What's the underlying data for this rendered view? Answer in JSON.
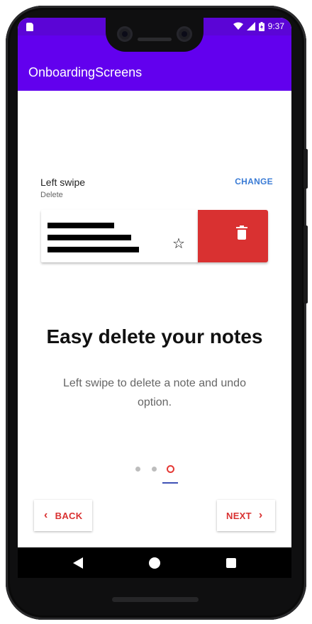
{
  "status_bar": {
    "time": "9:37"
  },
  "app_bar": {
    "title": "OnboardingScreens"
  },
  "demo": {
    "title": "Left swipe",
    "subtitle": "Delete",
    "change_label": "CHANGE"
  },
  "onboarding": {
    "headline": "Easy delete your notes",
    "description": "Left swipe to delete a note and undo option.",
    "page_index": 3,
    "page_count": 3
  },
  "buttons": {
    "back_label": "BACK",
    "next_label": "NEXT"
  },
  "colors": {
    "status_bar": "#5b05d6",
    "app_bar": "#6200ee",
    "delete_red": "#d93131",
    "change_blue": "#3a7bd5",
    "indicator_active": "#e53935"
  },
  "icons": {
    "star": "star-outline-icon",
    "trash": "trash-icon",
    "back": "chevron-left-icon",
    "next": "chevron-right-icon"
  }
}
